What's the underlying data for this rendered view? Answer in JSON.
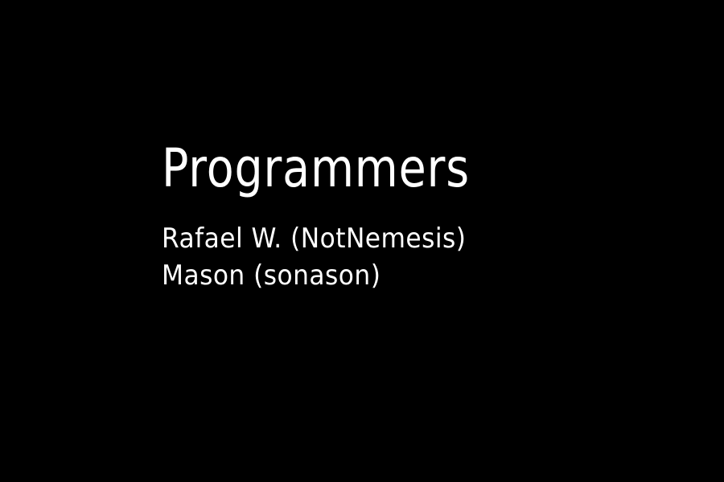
{
  "credits": {
    "section_title": "Programmers",
    "names": [
      "Rafael W. (NotNemesis)",
      "Mason (sonason)"
    ]
  },
  "colors": {
    "background": "#000000",
    "text": "#ffffff"
  }
}
